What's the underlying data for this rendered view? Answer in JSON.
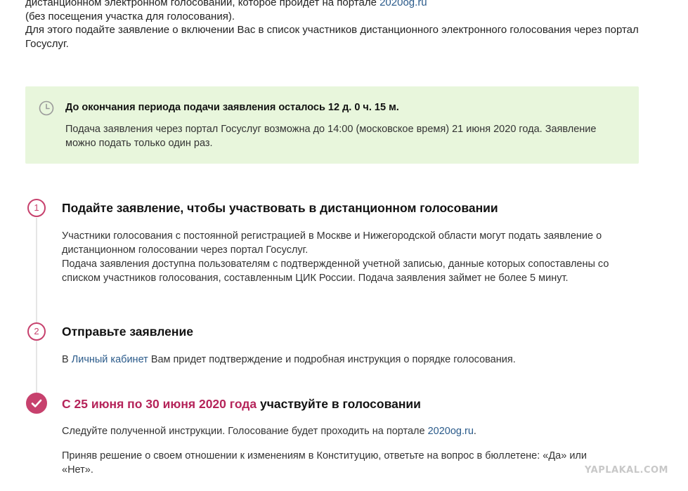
{
  "intro": {
    "line1_text": "дистанционном электронном голосовании, которое пройдет на портале ",
    "line1_link": "2020og.ru",
    "line2": "(без посещения участка для голосования).",
    "line3": "Для этого подайте заявление о включении Вас в список участников дистанционного электронного голосования через портал",
    "line4": "Госуслуг."
  },
  "notice": {
    "icon": "clock-icon",
    "title": "До окончания периода подачи заявления осталось 12 д. 0 ч. 15 м.",
    "desc_line1": "Подача заявления через портал Госуслуг возможна до 14:00 (московское время) 21 июня 2020 года. Заявление",
    "desc_line2": "можно подать только один раз."
  },
  "steps": [
    {
      "number": "1",
      "title": "Подайте заявление, чтобы участвовать в дистанционном голосовании",
      "lines": [
        "Участники голосования с постоянной регистрацией в Москве и Нижегородской области могут подать заявление о",
        "дистанционном голосовании через портал Госуслуг.",
        "Подача заявления доступна пользователям с подтвержденной учетной записью, данные которых сопоставлены со",
        "списком участников голосования, составленным ЦИК России. Подача заявления займет не более 5 минут."
      ]
    },
    {
      "number": "2",
      "title": "Отправьте заявление",
      "text_prefix": "В ",
      "link": "Личный кабинет",
      "text_suffix": " Вам придет подтверждение и подробная инструкция о порядке голосования."
    },
    {
      "icon": "checkmark-icon",
      "title_accent": "С 25 июня по 30 июня 2020 года",
      "title_rest": " участвуйте в голосовании",
      "p1_prefix": "Следуйте полученной инструкции. Голосование будет проходить на портале ",
      "p1_link": "2020og.ru",
      "p1_suffix": ".",
      "p2_line1": "Приняв решение о своем отношении к изменениям в Конституцию, ответьте на вопрос в бюллетене: «Да» или",
      "p2_line2": "«Нет»."
    }
  ],
  "watermark": "YAPLAKAL.COM",
  "colors": {
    "accent": "#c7416d",
    "notice_bg": "#e8f6dc",
    "link": "#2a5a8a"
  }
}
